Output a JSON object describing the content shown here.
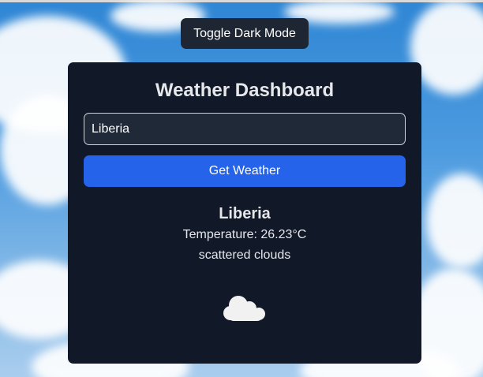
{
  "toggle_button": {
    "label": "Toggle Dark Mode"
  },
  "dashboard": {
    "title": "Weather Dashboard",
    "search": {
      "value": "Liberia",
      "placeholder": ""
    },
    "get_button_label": "Get Weather",
    "result": {
      "city": "Liberia",
      "temperature_text": "Temperature: 26.23°C",
      "description": "scattered clouds",
      "icon": "cloud-icon"
    }
  },
  "colors": {
    "card_bg": "#111827",
    "input_bg": "#1f2937",
    "primary_button": "#2563eb",
    "toggle_button_bg": "#1f2633",
    "text_light": "#e5e7eb"
  }
}
